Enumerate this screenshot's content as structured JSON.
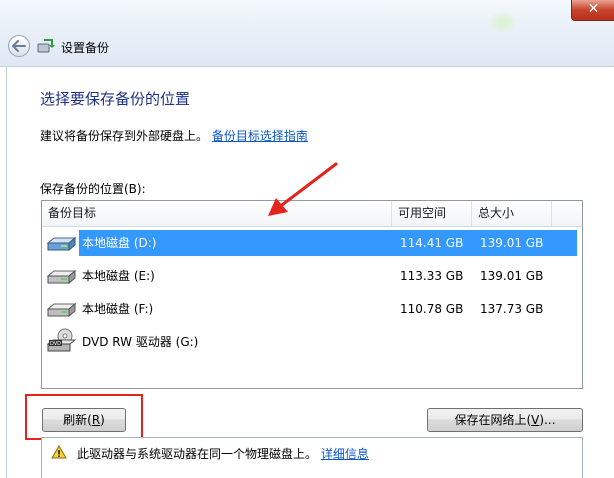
{
  "window": {
    "title": "设置备份",
    "close_symbol": "✕"
  },
  "page": {
    "heading": "选择要保存备份的位置",
    "suggestion_text": "建议将备份保存到外部硬盘上。",
    "suggestion_link": "备份目标选择指南",
    "location_label": "保存备份的位置(B):"
  },
  "table": {
    "headers": [
      "备份目标",
      "可用空间",
      "总大小"
    ],
    "rows": [
      {
        "name": "本地磁盘 (D:)",
        "free": "114.41 GB",
        "total": "139.01 GB",
        "icon": "hard-drive-icon",
        "selected": true
      },
      {
        "name": "本地磁盘 (E:)",
        "free": "113.33 GB",
        "total": "139.01 GB",
        "icon": "hard-drive-icon",
        "selected": false
      },
      {
        "name": "本地磁盘 (F:)",
        "free": "110.78 GB",
        "total": "137.73 GB",
        "icon": "hard-drive-icon",
        "selected": false
      },
      {
        "name": "DVD RW 驱动器 (G:)",
        "free": "",
        "total": "",
        "icon": "dvd-drive-icon",
        "selected": false
      }
    ]
  },
  "buttons": {
    "refresh_pre": "刷新(",
    "refresh_key": "R",
    "refresh_post": ")",
    "save_online_pre": "保存在网络上(",
    "save_online_key": "V",
    "save_online_post": ")..."
  },
  "warning": {
    "text": "此驱动器与系统驱动器在同一个物理磁盘上。",
    "link": "详细信息"
  },
  "colors": {
    "heading": "#1e3287",
    "link": "#0b57c7",
    "selection": "#3399ff",
    "annotation": "#e3231c"
  }
}
